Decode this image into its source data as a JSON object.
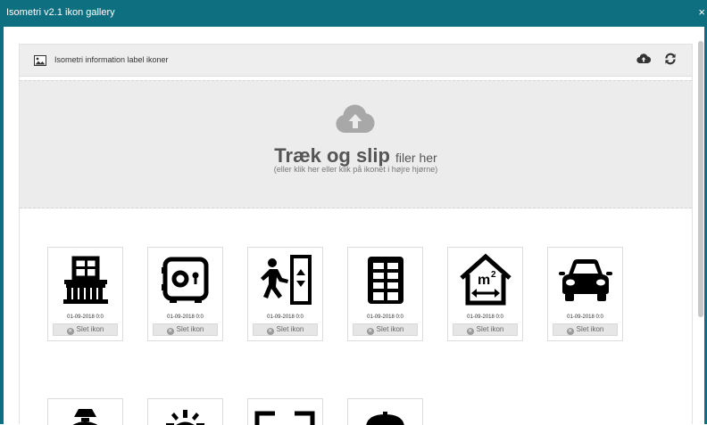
{
  "window": {
    "title": "Isometri v2.1 ikon gallery",
    "close_label": "×"
  },
  "panel": {
    "title": "Isometri information label ikoner"
  },
  "dropzone": {
    "main_bold": "Træk og slip",
    "main_rest": "filer her",
    "sub": "(eller klik her eller klik på ikonet i højre hjørne)"
  },
  "icons": [
    {
      "name": "balcony",
      "date": "01-09-2018 0:0",
      "delete_label": "Slet ikon"
    },
    {
      "name": "safe",
      "date": "01-09-2018 0:0",
      "delete_label": "Slet ikon"
    },
    {
      "name": "elevator",
      "date": "01-09-2018 0:0",
      "delete_label": "Slet ikon"
    },
    {
      "name": "building",
      "date": "01-09-2018 0:0",
      "delete_label": "Slet ikon"
    },
    {
      "name": "area-m2",
      "date": "01-09-2018 0:0",
      "delete_label": "Slet ikon"
    },
    {
      "name": "car",
      "date": "01-09-2018 0:0",
      "delete_label": "Slet ikon"
    }
  ],
  "icons_row2": [
    "lamp",
    "sun",
    "expand",
    "dome"
  ]
}
